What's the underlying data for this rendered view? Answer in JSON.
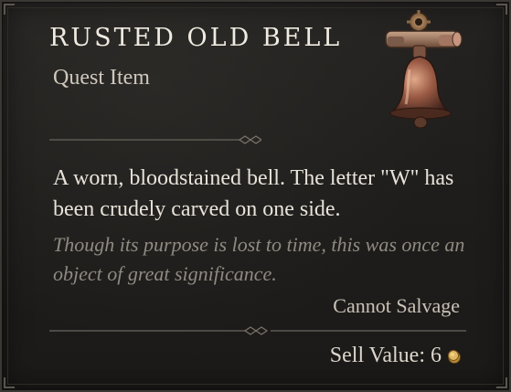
{
  "item": {
    "name": "RUSTED OLD BELL",
    "type": "Quest Item",
    "description": "A worn, bloodstained bell. The letter \"W\" has been crudely carved on one side.",
    "flavor_text": "Though its purpose is lost to time, this was once an object of great significance.",
    "salvage": "Cannot Salvage",
    "sell_label": "Sell Value: 6",
    "icon": "bell-icon",
    "currency_icon": "gold-coin-icon"
  },
  "colors": {
    "background": "#1f1d1b",
    "title": "#f0ebe1",
    "body_text": "#e8e3da",
    "flavor_text": "#8f8a82",
    "border": "#3b3834"
  }
}
